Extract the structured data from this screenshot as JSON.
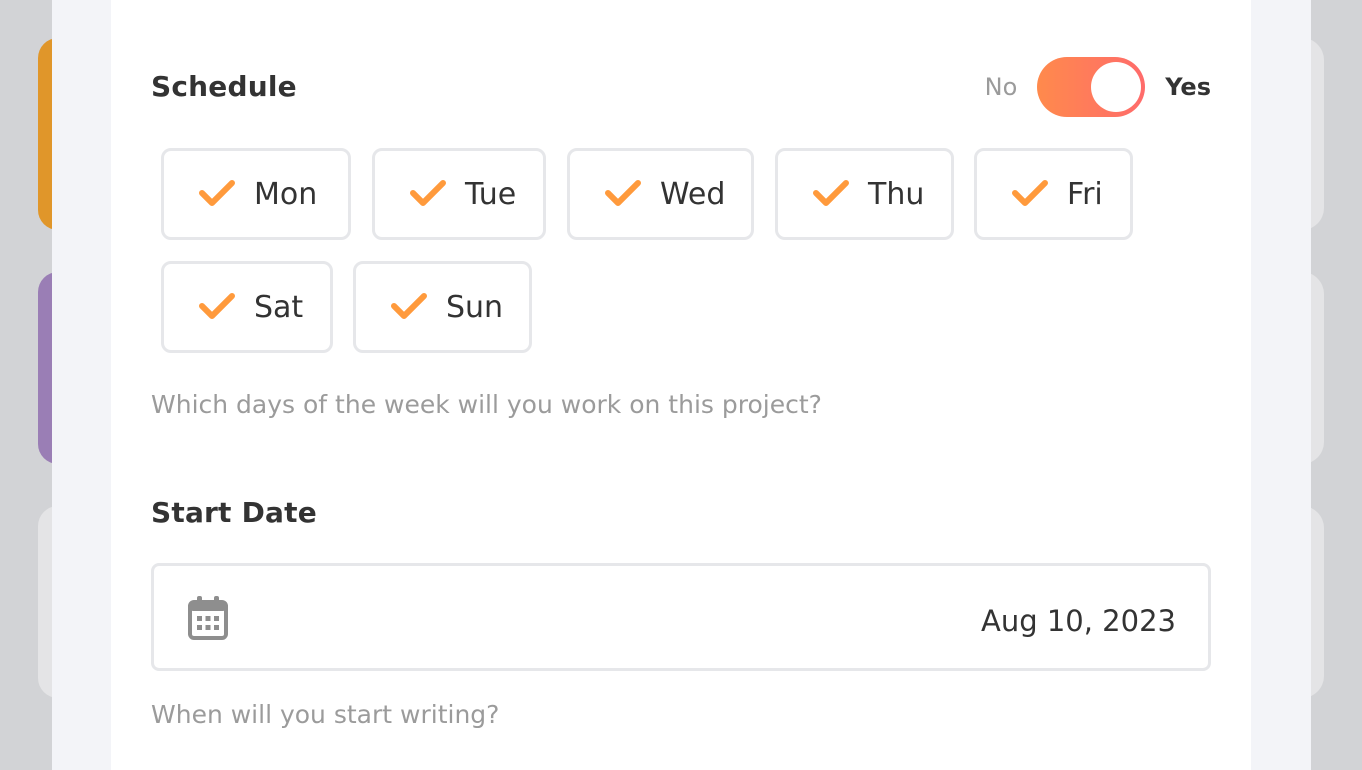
{
  "colors": {
    "accent": "#ff8a4c",
    "accent_end": "#ff6b6b",
    "check": "#ff9a3c",
    "muted_text": "#9b9b9b",
    "text": "#333333"
  },
  "schedule": {
    "title": "Schedule",
    "toggle": {
      "off_label": "No",
      "on_label": "Yes",
      "state": "on"
    },
    "days": [
      {
        "label": "Mon",
        "checked": true
      },
      {
        "label": "Tue",
        "checked": true
      },
      {
        "label": "Wed",
        "checked": true
      },
      {
        "label": "Thu",
        "checked": true
      },
      {
        "label": "Fri",
        "checked": true
      },
      {
        "label": "Sat",
        "checked": true
      },
      {
        "label": "Sun",
        "checked": true
      }
    ],
    "help": "Which days of the week will you work on this project?"
  },
  "start_date": {
    "title": "Start Date",
    "icon": "calendar-icon",
    "value": "Aug 10, 2023",
    "help": "When will you start writing?"
  }
}
